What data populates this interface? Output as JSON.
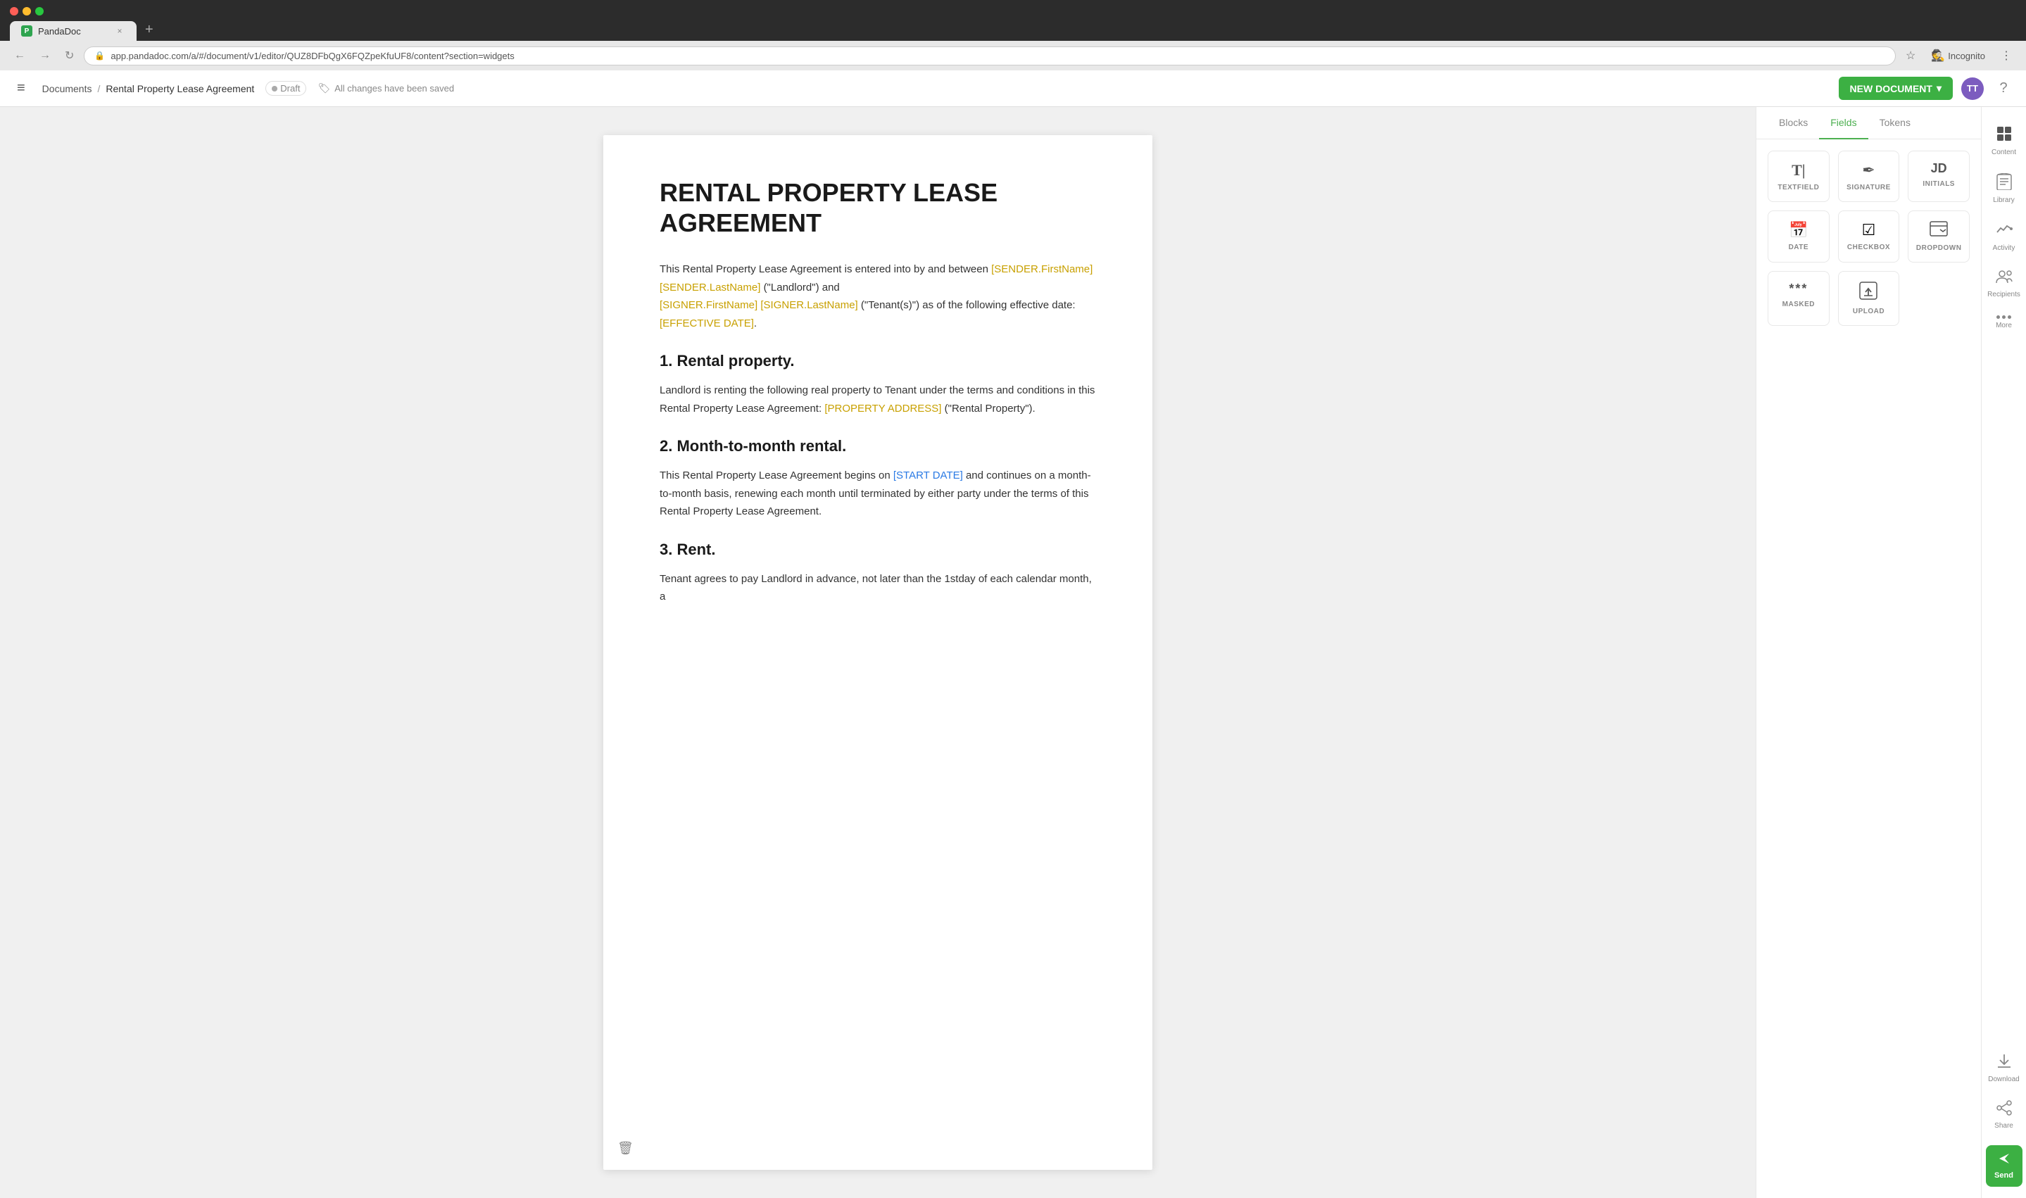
{
  "browser": {
    "tab_favicon": "P",
    "tab_title": "PandaDoc",
    "tab_close": "×",
    "tab_new": "+",
    "url": "app.pandadoc.com/a/#/document/v1/editor/QUZ8DFbQgX6FQZpeKfuUF8/content?section=widgets",
    "incognito_label": "Incognito"
  },
  "header": {
    "menu_icon": "≡",
    "breadcrumb": {
      "parent": "Documents",
      "separator": "/",
      "current": "Rental Property Lease Agreement"
    },
    "draft_label": "Draft",
    "saved_status": "All changes have been saved",
    "new_doc_btn": "NEW DOCUMENT",
    "new_doc_arrow": "▾",
    "avatar_initials": "TT",
    "help_icon": "?"
  },
  "document": {
    "title": "RENTAL PROPERTY LEASE AGREEMENT",
    "intro": "This Rental Property Lease Agreement is entered into by and between",
    "sender_name": "[SENDER.FirstName] [SENDER.LastName]",
    "landlord_text": " (\"Landlord\") and",
    "signer_name": "[SIGNER.FirstName] [SIGNER.LastName]",
    "tenant_text": " (\"Tenant(s)\") as of the following effective date:",
    "effective_date": "[EFFECTIVE DATE]",
    "effective_date_end": ".",
    "section1_heading": "1. Rental property.",
    "section1_text1": "Landlord is renting the following real property to Tenant under the terms and conditions in this Rental Property Lease Agreement:",
    "property_address": "[PROPERTY ADDRESS]",
    "section1_text2": " (\"Rental Property\").",
    "section2_heading": "2. Month-to-month rental.",
    "section2_text": "This Rental Property Lease Agreement begins on",
    "start_date": "[START DATE]",
    "section2_text2": " and continues on a month-to-month basis, renewing each month until terminated by either party under the terms of this Rental Property Lease Agreement.",
    "section3_heading": "3. Rent.",
    "section3_text": "Tenant agrees to pay Landlord in advance, not later than the 1stday of each calendar month, a"
  },
  "sidebar": {
    "tabs": [
      {
        "id": "blocks",
        "label": "Blocks",
        "active": false
      },
      {
        "id": "fields",
        "label": "Fields",
        "active": true
      },
      {
        "id": "tokens",
        "label": "Tokens",
        "active": false
      }
    ],
    "fields": [
      {
        "id": "textfield",
        "label": "TEXTFIELD",
        "icon": "T|"
      },
      {
        "id": "signature",
        "label": "SIGNATURE",
        "icon": "✒"
      },
      {
        "id": "initials",
        "label": "INITIALS",
        "icon": "JD"
      },
      {
        "id": "date",
        "label": "DATE",
        "icon": "📅"
      },
      {
        "id": "checkbox",
        "label": "CHECKBOX",
        "icon": "☑"
      },
      {
        "id": "dropdown",
        "label": "DROPDOWN",
        "icon": "▤"
      },
      {
        "id": "masked",
        "label": "MASKED",
        "icon": "***"
      },
      {
        "id": "upload",
        "label": "UPLOAD",
        "icon": "⬆"
      }
    ]
  },
  "icon_rail": {
    "items": [
      {
        "id": "content",
        "label": "Content",
        "icon": "⊞"
      },
      {
        "id": "library",
        "label": "Library",
        "icon": "📚"
      },
      {
        "id": "activity",
        "label": "Activity",
        "icon": "📈"
      },
      {
        "id": "recipients",
        "label": "Recipients",
        "icon": "👥"
      },
      {
        "id": "more",
        "label": "More",
        "icon": "•••"
      },
      {
        "id": "download",
        "label": "Download",
        "icon": "⬇"
      },
      {
        "id": "share",
        "label": "Share",
        "icon": "🔗"
      }
    ],
    "send_label": "Send",
    "send_icon": "➤"
  },
  "colors": {
    "active_tab": "#4CAF50",
    "new_doc_btn": "#3cb043",
    "send_btn": "#3cb043",
    "token_yellow": "#c8a000",
    "token_blue": "#2a7ae4"
  }
}
